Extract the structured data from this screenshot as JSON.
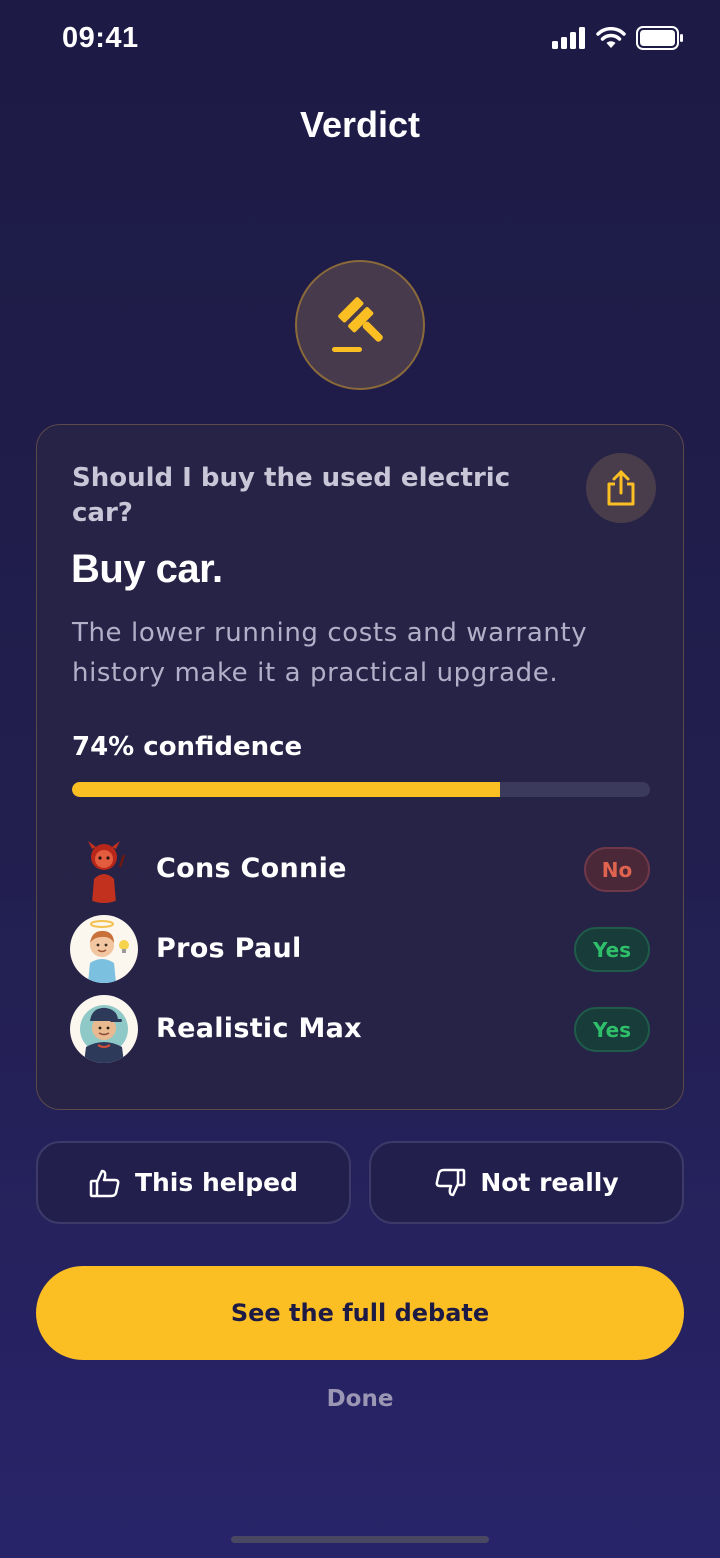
{
  "status_bar": {
    "time": "09:41"
  },
  "header": {
    "title": "Verdict"
  },
  "card": {
    "question": "Should I buy the used electric car?",
    "verdict": "Buy car.",
    "summary": "The lower running costs and warranty history make it a practical upgrade.",
    "confidence_label": "74% confidence",
    "confidence": 0.74
  },
  "agents": [
    {
      "name": "Cons Connie",
      "vote": "No"
    },
    {
      "name": "Pros Paul",
      "vote": "Yes"
    },
    {
      "name": "Realistic Max",
      "vote": "Yes"
    }
  ],
  "feedback": {
    "helped_label": "This helped",
    "not_really_label": "Not really"
  },
  "actions": {
    "primary_label": "See the full debate",
    "done_label": "Done"
  },
  "colors": {
    "accent": "#fbbf24",
    "background": "#1d1a45",
    "card": "#272347",
    "no": "#e0634f",
    "yes": "#2fbf6a"
  },
  "icons": {
    "verdict": "gavel-icon",
    "share": "share-icon",
    "helped": "thumbs-up-icon",
    "not_really": "thumbs-down-icon"
  }
}
